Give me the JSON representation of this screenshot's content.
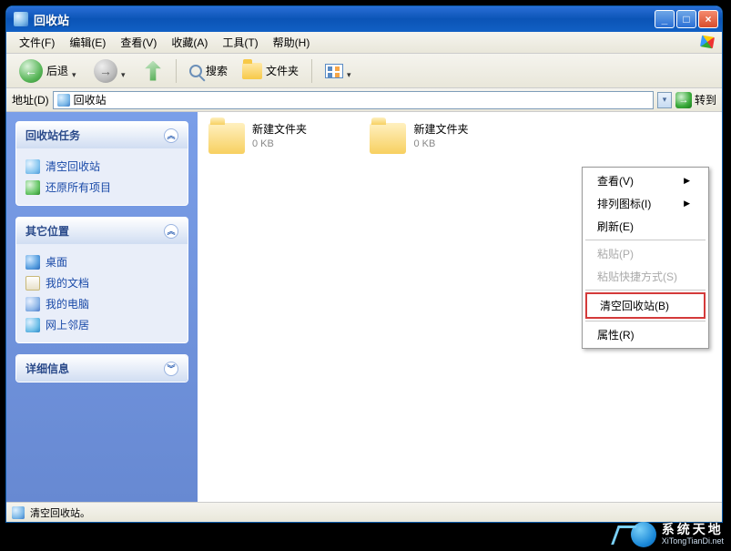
{
  "window": {
    "title": "回收站"
  },
  "menu": {
    "file": "文件(F)",
    "edit": "编辑(E)",
    "view": "查看(V)",
    "fav": "收藏(A)",
    "tools": "工具(T)",
    "help": "帮助(H)"
  },
  "toolbar": {
    "back": "后退",
    "search": "搜索",
    "folders": "文件夹"
  },
  "address": {
    "label": "地址(D)",
    "value": "回收站",
    "go": "转到"
  },
  "sidebar": {
    "tasks": {
      "title": "回收站任务",
      "items": [
        {
          "icon": "empty",
          "label": "清空回收站"
        },
        {
          "icon": "restore",
          "label": "还原所有项目"
        }
      ]
    },
    "other": {
      "title": "其它位置",
      "items": [
        {
          "icon": "desktop",
          "label": "桌面"
        },
        {
          "icon": "docs",
          "label": "我的文档"
        },
        {
          "icon": "pc",
          "label": "我的电脑"
        },
        {
          "icon": "net",
          "label": "网上邻居"
        }
      ]
    },
    "details": {
      "title": "详细信息"
    }
  },
  "files": [
    {
      "name": "新建文件夹",
      "size": "0 KB"
    },
    {
      "name": "新建文件夹",
      "size": "0 KB"
    }
  ],
  "context": {
    "view": "查看(V)",
    "arrange": "排列图标(I)",
    "refresh": "刷新(E)",
    "paste": "粘贴(P)",
    "paste_shortcut": "粘贴快捷方式(S)",
    "empty": "清空回收站(B)",
    "props": "属性(R)"
  },
  "status": {
    "text": "清空回收站。"
  },
  "watermark": {
    "cn": "系统天地",
    "en": "XiTongTianDi.net"
  }
}
